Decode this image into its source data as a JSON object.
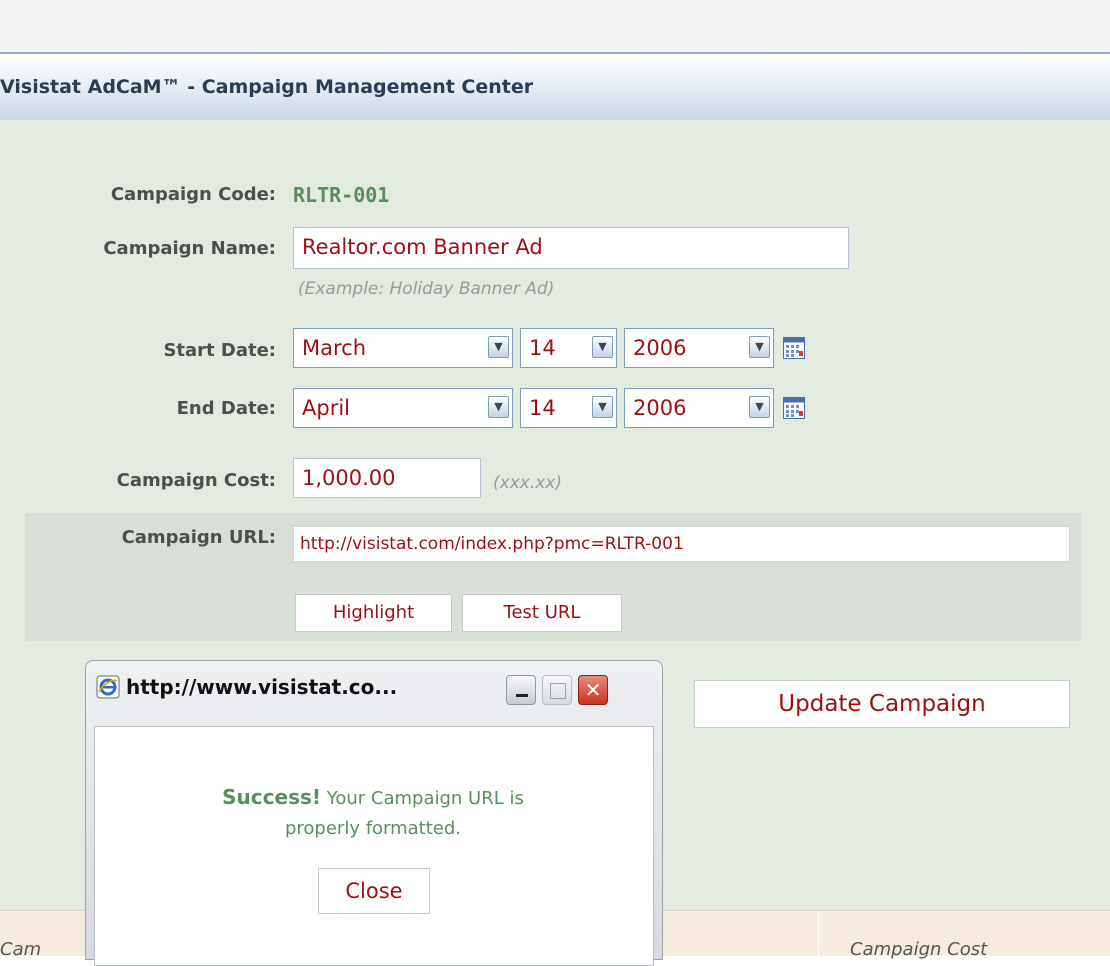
{
  "header": {
    "title": "Visistat AdCaM™ - Campaign Management Center"
  },
  "form": {
    "campaign_code_label": "Campaign Code:",
    "campaign_code_value": "RLTR-001",
    "campaign_name_label": "Campaign Name:",
    "campaign_name_value": "Realtor.com Banner Ad",
    "campaign_name_hint": "(Example: Holiday Banner Ad)",
    "start_date_label": "Start Date:",
    "start_month": "March",
    "start_day": "14",
    "start_year": "2006",
    "end_date_label": "End Date:",
    "end_month": "April",
    "end_day": "14",
    "end_year": "2006",
    "campaign_cost_label": "Campaign Cost:",
    "campaign_cost_value": "1,000.00",
    "campaign_cost_hint": "(xxx.xx)",
    "campaign_url_label": "Campaign URL:",
    "campaign_url_value": "http://visistat.com/index.php?pmc=RLTR-001",
    "highlight_button": "Highlight",
    "test_url_button": "Test URL",
    "update_button": "Update Campaign"
  },
  "table_header": {
    "col_campaign": "Cam",
    "col_cost": "Campaign Cost"
  },
  "popup": {
    "title": "http://www.visistat.co...",
    "success_word": "Success!",
    "message_line1": " Your Campaign URL is",
    "message_line2": "properly formatted.",
    "close_button": "Close"
  },
  "colors": {
    "accent_green": "#5a8f5d",
    "value_red": "#9a1111",
    "panel_bg": "#e3eadf"
  }
}
